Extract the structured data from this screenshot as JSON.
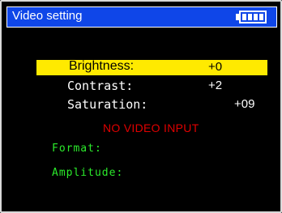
{
  "title": "Video setting",
  "battery_icon": "battery-full-icon",
  "colors": {
    "title_bg": "#0f46e8",
    "highlight": "#ffea00",
    "alert": "#e00000",
    "info": "#2bea2b"
  },
  "menu": [
    {
      "label": "Brightness:",
      "value": "+0",
      "selected": true
    },
    {
      "label": "Contrast:",
      "value": "+2",
      "selected": false
    },
    {
      "label": "Saturation:",
      "value": "+09",
      "selected": false
    }
  ],
  "status": "NO VIDEO INPUT",
  "format_label": "Format:",
  "amplitude_label": "Amplitude:"
}
